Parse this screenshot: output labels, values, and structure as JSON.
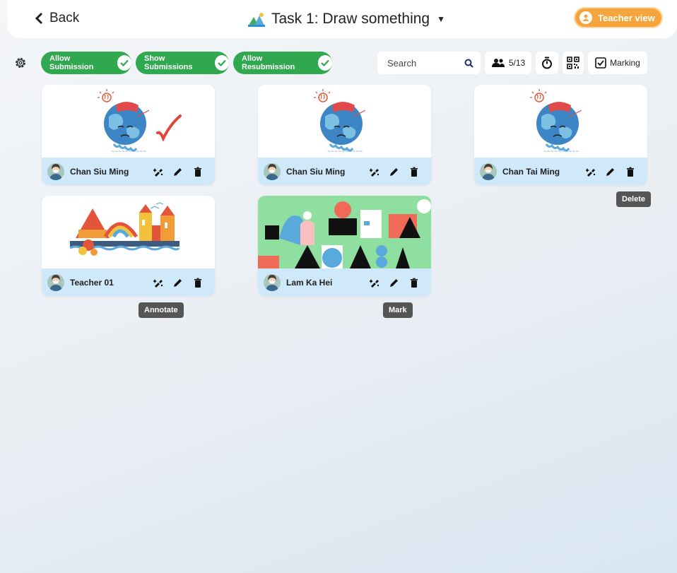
{
  "header": {
    "back_label": "Back",
    "task_title": "Task 1: Draw something",
    "teacher_view_label": "Teacher view"
  },
  "toolbar": {
    "allow_submission": "Allow Submission",
    "show_submissions": "Show Submissions",
    "allow_resubmission": "Allow Resubmission",
    "search_placeholder": "Search",
    "student_count": "5/13",
    "marking_label": "Marking"
  },
  "submissions": [
    {
      "name": "Chan Siu Ming",
      "image": "earth-drawing",
      "marked": true
    },
    {
      "name": "Chan Siu Ming",
      "image": "earth-drawing",
      "marked": false
    },
    {
      "name": "Chan Tai Ming",
      "image": "earth-drawing",
      "marked": false
    },
    {
      "name": "Teacher 01",
      "image": "city-drawing",
      "marked": false
    },
    {
      "name": "Lam Ka Hei",
      "image": "abstract-collage",
      "marked": false
    }
  ],
  "tooltips": {
    "delete": "Delete",
    "annotate": "Annotate",
    "mark": "Mark"
  },
  "colors": {
    "accent_green": "#2fa84f",
    "teacher_orange": "#f5a53b",
    "card_footer": "#cfe8fa",
    "check_red": "#e0463c"
  },
  "icons": [
    "chevron-left-icon",
    "artwork-icon",
    "caret-down-icon",
    "user-icon",
    "gear-icon",
    "check-icon",
    "search-icon",
    "group-icon",
    "timer-icon",
    "qr-code-icon",
    "checkbox-icon",
    "annotate-icon",
    "pencil-icon",
    "trash-icon"
  ]
}
